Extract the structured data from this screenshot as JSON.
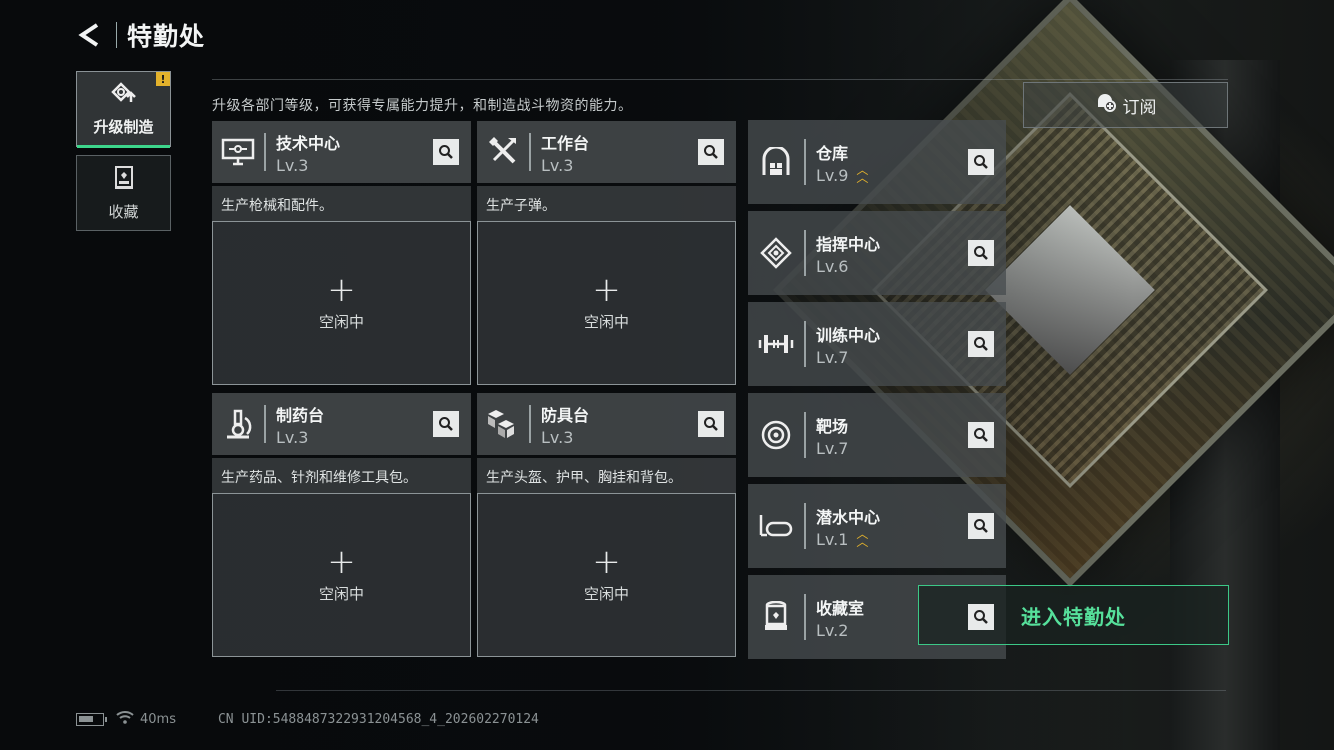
{
  "header": {
    "title": "特勤处",
    "back_icon": "back-arrow-icon"
  },
  "sidebar": {
    "items": [
      {
        "label": "升级制造",
        "icon": "upgrade-icon",
        "active": true,
        "badge": "!"
      },
      {
        "label": "收藏",
        "icon": "collection-icon",
        "active": false
      }
    ]
  },
  "description": "升级各部门等级，可获得专属能力提升，和制造战斗物资的能力。",
  "subscribe": {
    "label": "订阅",
    "icon": "subscribe-icon"
  },
  "workstations": [
    {
      "name": "技术中心",
      "level": "Lv.3",
      "desc": "生产枪械和配件。",
      "slot_status": "空闲中",
      "icon": "computer-icon"
    },
    {
      "name": "工作台",
      "level": "Lv.3",
      "desc": "生产子弹。",
      "slot_status": "空闲中",
      "icon": "tools-icon"
    },
    {
      "name": "制药台",
      "level": "Lv.3",
      "desc": "生产药品、针剂和维修工具包。",
      "slot_status": "空闲中",
      "icon": "microscope-icon"
    },
    {
      "name": "防具台",
      "level": "Lv.3",
      "desc": "生产头盔、护甲、胸挂和背包。",
      "slot_status": "空闲中",
      "icon": "armor-cubes-icon"
    }
  ],
  "facilities": [
    {
      "name": "仓库",
      "level": "Lv.9",
      "upgradable": true,
      "icon": "warehouse-icon"
    },
    {
      "name": "指挥中心",
      "level": "Lv.6",
      "upgradable": false,
      "icon": "command-chip-icon"
    },
    {
      "name": "训练中心",
      "level": "Lv.7",
      "upgradable": false,
      "icon": "dumbbell-icon"
    },
    {
      "name": "靶场",
      "level": "Lv.7",
      "upgradable": false,
      "icon": "target-icon"
    },
    {
      "name": "潜水中心",
      "level": "Lv.1",
      "upgradable": true,
      "icon": "diving-mask-icon"
    },
    {
      "name": "收藏室",
      "level": "Lv.2",
      "upgradable": false,
      "icon": "display-case-icon"
    }
  ],
  "enter_button": "进入特勤处",
  "status_bar": {
    "ping": "40ms",
    "uid": "CN UID:5488487322931204568_4_202602270124"
  },
  "colors": {
    "accent_green": "#3cc887",
    "warning_yellow": "#e3b22c"
  }
}
